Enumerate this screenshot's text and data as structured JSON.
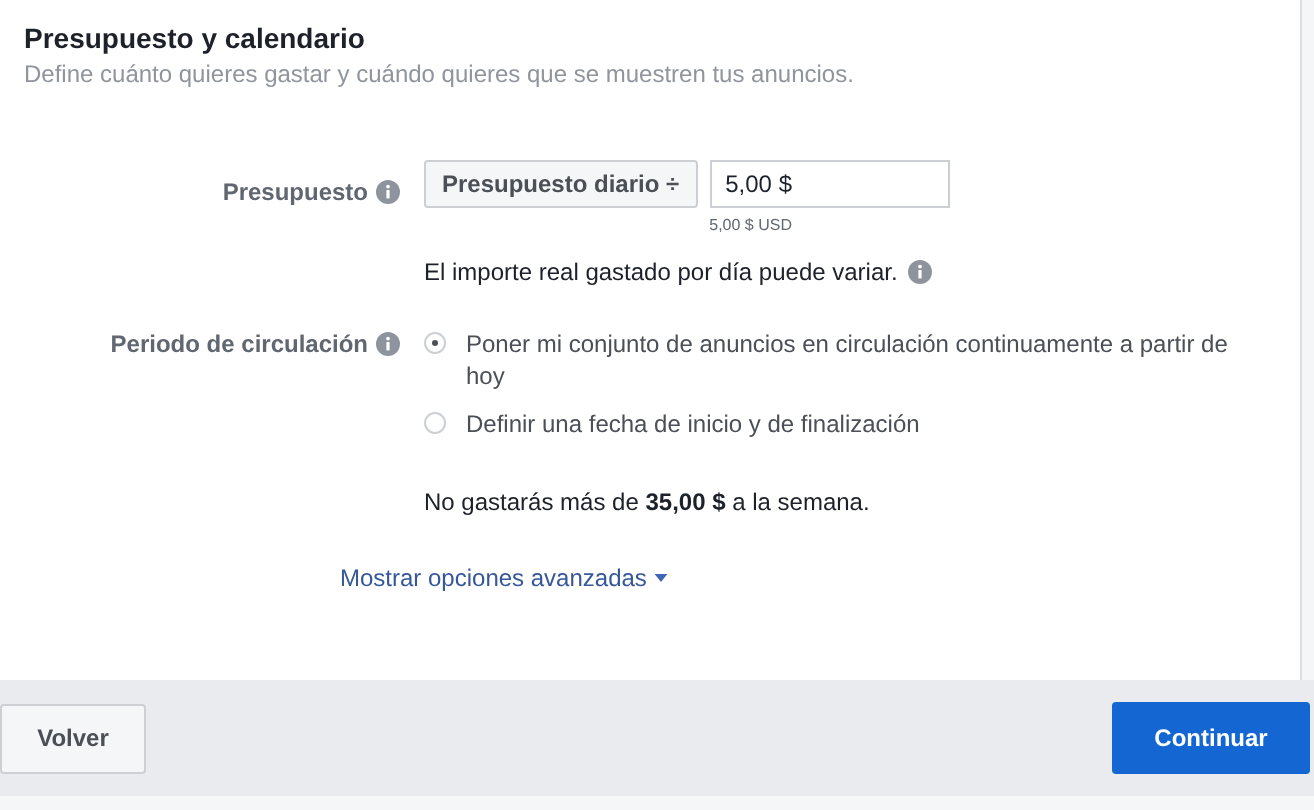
{
  "section": {
    "title": "Presupuesto y calendario",
    "subtitle": "Define cuánto quieres gastar y cuándo quieres que se muestren tus anuncios."
  },
  "budget": {
    "label": "Presupuesto",
    "type_select": "Presupuesto diario",
    "select_arrow": "÷",
    "amount": "5,00 $",
    "amount_hint": "5,00 $ USD",
    "note": "El importe real gastado por día puede variar."
  },
  "schedule": {
    "label": "Periodo de circulación",
    "options": [
      {
        "label": "Poner mi conjunto de anuncios en circulación continuamente a partir de hoy",
        "selected": true
      },
      {
        "label": "Definir una fecha de inicio y de finalización",
        "selected": false
      }
    ]
  },
  "weekly_note": "No gastarás más de **35,00 $** a la semana.",
  "advanced_link": "Mostrar opciones avanzadas",
  "footer": {
    "back": "Volver",
    "continue": "Continuar"
  }
}
